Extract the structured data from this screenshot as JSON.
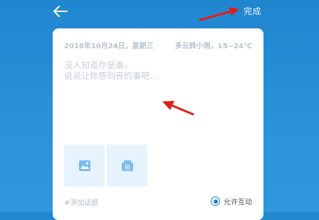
{
  "header": {
    "back_icon": "arrow-left-icon",
    "done_label": "完成"
  },
  "compose": {
    "date_weekday": "2018年10月24日，星期三",
    "weather": "多云转小雨，15~24℃",
    "placeholder_lines": "没人知道你是谁，\n说说让你感到丧的事吧…",
    "attachments": [
      {
        "icon": "image-icon"
      },
      {
        "icon": "vote-icon",
        "glyph": "投"
      }
    ],
    "add_topic_label": "#添加话题",
    "allow_interact_label": "允许互动",
    "allow_interact_checked": true
  },
  "colors": {
    "background": "#2a8fd7",
    "accent": "#1f7fcc",
    "tile_background": "#e6f2fc",
    "annotation_arrow": "#e01d1d"
  }
}
